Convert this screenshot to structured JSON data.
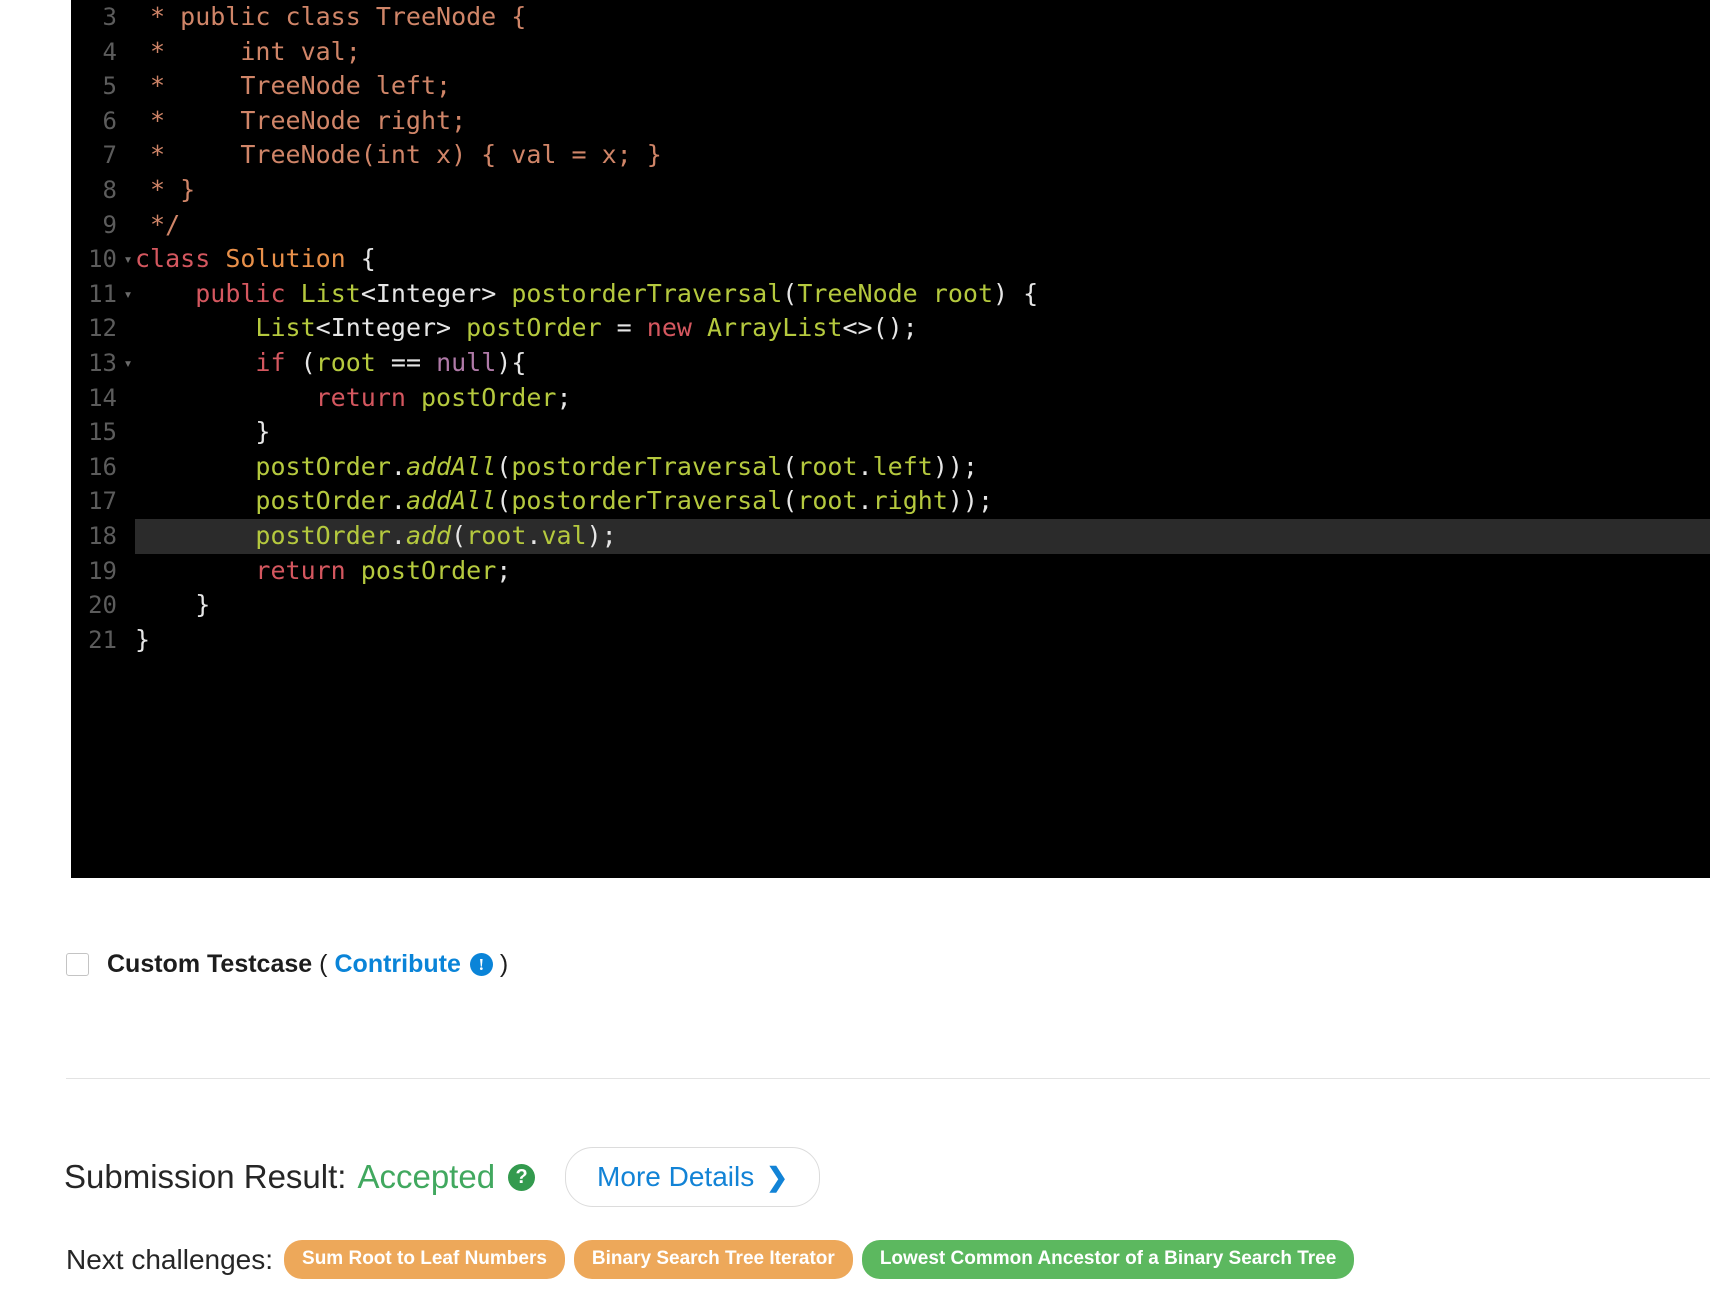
{
  "editor": {
    "language": "java",
    "active_line": 18,
    "background": "#000000",
    "active_line_color": "#2b2b2b",
    "colors": {
      "comment": "#d08568",
      "keyword": "#d4575f",
      "class_name": "#e8904a",
      "identifier": "#b5c93e",
      "punctuation": "#e6e6e6",
      "null_literal": "#b07aa8",
      "line_number": "#5c5c5c"
    },
    "lines": [
      {
        "num": "3",
        "fold": "",
        "active": false,
        "tokens": [
          {
            "t": "com",
            "v": " * public class TreeNode {"
          }
        ]
      },
      {
        "num": "4",
        "fold": "",
        "active": false,
        "tokens": [
          {
            "t": "com",
            "v": " *     int val;"
          }
        ]
      },
      {
        "num": "5",
        "fold": "",
        "active": false,
        "tokens": [
          {
            "t": "com",
            "v": " *     TreeNode left;"
          }
        ]
      },
      {
        "num": "6",
        "fold": "",
        "active": false,
        "tokens": [
          {
            "t": "com",
            "v": " *     TreeNode right;"
          }
        ]
      },
      {
        "num": "7",
        "fold": "",
        "active": false,
        "tokens": [
          {
            "t": "com",
            "v": " *     TreeNode(int x) { val = x; }"
          }
        ]
      },
      {
        "num": "8",
        "fold": "",
        "active": false,
        "tokens": [
          {
            "t": "com",
            "v": " * }"
          }
        ]
      },
      {
        "num": "9",
        "fold": "",
        "active": false,
        "tokens": [
          {
            "t": "com",
            "v": " */"
          }
        ]
      },
      {
        "num": "10",
        "fold": "▾",
        "active": false,
        "tokens": [
          {
            "t": "kw",
            "v": "class"
          },
          {
            "t": "pun",
            "v": " "
          },
          {
            "t": "cls",
            "v": "Solution"
          },
          {
            "t": "pun",
            "v": " {"
          }
        ]
      },
      {
        "num": "11",
        "fold": "▾",
        "active": false,
        "tokens": [
          {
            "t": "pun",
            "v": "    "
          },
          {
            "t": "kw",
            "v": "public"
          },
          {
            "t": "pun",
            "v": " "
          },
          {
            "t": "id",
            "v": "List"
          },
          {
            "t": "pun",
            "v": "<Integer> "
          },
          {
            "t": "id",
            "v": "postorderTraversal"
          },
          {
            "t": "pun",
            "v": "("
          },
          {
            "t": "id",
            "v": "TreeNode root"
          },
          {
            "t": "pun",
            "v": ") {"
          }
        ]
      },
      {
        "num": "12",
        "fold": "",
        "active": false,
        "tokens": [
          {
            "t": "pun",
            "v": "        "
          },
          {
            "t": "id",
            "v": "List"
          },
          {
            "t": "pun",
            "v": "<Integer> "
          },
          {
            "t": "id",
            "v": "postOrder"
          },
          {
            "t": "pun",
            "v": " = "
          },
          {
            "t": "kw",
            "v": "new"
          },
          {
            "t": "pun",
            "v": " "
          },
          {
            "t": "id",
            "v": "ArrayList"
          },
          {
            "t": "pun",
            "v": "<>();"
          }
        ]
      },
      {
        "num": "13",
        "fold": "▾",
        "active": false,
        "tokens": [
          {
            "t": "pun",
            "v": "        "
          },
          {
            "t": "kw",
            "v": "if"
          },
          {
            "t": "pun",
            "v": " ("
          },
          {
            "t": "id",
            "v": "root"
          },
          {
            "t": "pun",
            "v": " == "
          },
          {
            "t": "null",
            "v": "null"
          },
          {
            "t": "pun",
            "v": "){"
          }
        ]
      },
      {
        "num": "14",
        "fold": "",
        "active": false,
        "tokens": [
          {
            "t": "pun",
            "v": "            "
          },
          {
            "t": "kw",
            "v": "return"
          },
          {
            "t": "pun",
            "v": " "
          },
          {
            "t": "id",
            "v": "postOrder"
          },
          {
            "t": "pun",
            "v": ";"
          }
        ]
      },
      {
        "num": "15",
        "fold": "",
        "active": false,
        "tokens": [
          {
            "t": "pun",
            "v": "        }"
          }
        ]
      },
      {
        "num": "16",
        "fold": "",
        "active": false,
        "tokens": [
          {
            "t": "pun",
            "v": "        "
          },
          {
            "t": "id",
            "v": "postOrder"
          },
          {
            "t": "pun",
            "v": "."
          },
          {
            "t": "idi",
            "v": "addAll"
          },
          {
            "t": "pun",
            "v": "("
          },
          {
            "t": "id",
            "v": "postorderTraversal"
          },
          {
            "t": "pun",
            "v": "("
          },
          {
            "t": "id",
            "v": "root"
          },
          {
            "t": "pun",
            "v": "."
          },
          {
            "t": "id",
            "v": "left"
          },
          {
            "t": "pun",
            "v": "));"
          }
        ]
      },
      {
        "num": "17",
        "fold": "",
        "active": false,
        "tokens": [
          {
            "t": "pun",
            "v": "        "
          },
          {
            "t": "id",
            "v": "postOrder"
          },
          {
            "t": "pun",
            "v": "."
          },
          {
            "t": "idi",
            "v": "addAll"
          },
          {
            "t": "pun",
            "v": "("
          },
          {
            "t": "id",
            "v": "postorderTraversal"
          },
          {
            "t": "pun",
            "v": "("
          },
          {
            "t": "id",
            "v": "root"
          },
          {
            "t": "pun",
            "v": "."
          },
          {
            "t": "id",
            "v": "right"
          },
          {
            "t": "pun",
            "v": "));"
          }
        ]
      },
      {
        "num": "18",
        "fold": "",
        "active": true,
        "tokens": [
          {
            "t": "pun",
            "v": "        "
          },
          {
            "t": "id",
            "v": "postOrder"
          },
          {
            "t": "pun",
            "v": "."
          },
          {
            "t": "idi",
            "v": "add"
          },
          {
            "t": "pun",
            "v": "("
          },
          {
            "t": "id",
            "v": "root"
          },
          {
            "t": "pun",
            "v": "."
          },
          {
            "t": "id",
            "v": "val"
          },
          {
            "t": "pun",
            "v": ");"
          }
        ]
      },
      {
        "num": "19",
        "fold": "",
        "active": false,
        "tokens": [
          {
            "t": "pun",
            "v": "        "
          },
          {
            "t": "kw",
            "v": "return"
          },
          {
            "t": "pun",
            "v": " "
          },
          {
            "t": "id",
            "v": "postOrder"
          },
          {
            "t": "pun",
            "v": ";"
          }
        ]
      },
      {
        "num": "20",
        "fold": "",
        "active": false,
        "tokens": [
          {
            "t": "pun",
            "v": "    }"
          }
        ]
      },
      {
        "num": "21",
        "fold": "",
        "active": false,
        "tokens": [
          {
            "t": "pun",
            "v": "}"
          }
        ]
      }
    ]
  },
  "testcase": {
    "checked": false,
    "label": "Custom Testcase",
    "open_paren": "(",
    "contribute_label": "Contribute",
    "info_icon": "!",
    "close_paren": ")"
  },
  "submission": {
    "title": "Submission Result:",
    "status": "Accepted",
    "status_color": "#41a85f",
    "help_icon": "?",
    "more_details_label": "More Details",
    "chevron": "❯"
  },
  "next_challenges": {
    "label": "Next challenges:",
    "items": [
      {
        "label": "Sum Root to Leaf Numbers",
        "color": "#eda85a"
      },
      {
        "label": "Binary Search Tree Iterator",
        "color": "#eda85a"
      },
      {
        "label": "Lowest Common Ancestor of a Binary Search Tree",
        "color": "#5cb85f"
      }
    ]
  }
}
